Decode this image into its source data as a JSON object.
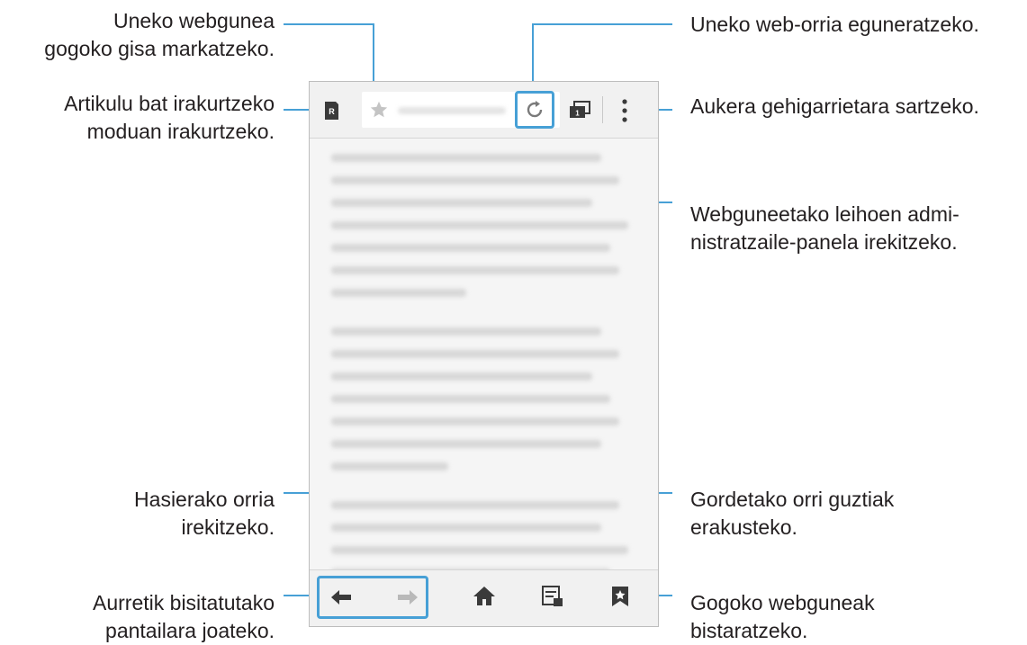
{
  "callouts": {
    "bookmark_page": [
      "Uneko webgunea",
      "gogoko gisa markatzeko."
    ],
    "reader_mode": [
      "Artikulu bat irakurtzeko",
      "moduan irakurtzeko."
    ],
    "refresh": [
      "Uneko web-orria eguneratzeko."
    ],
    "more_options": [
      "Aukera gehigarrietara sartzeko."
    ],
    "window_manager": [
      "Webguneetako leihoen admi-",
      "nistratzaile-panela irekitzeko."
    ],
    "home_page": [
      "Hasierako orria",
      "irekitzeko."
    ],
    "saved_pages": [
      "Gordetako orri guztiak",
      "erakusteko."
    ],
    "back_forward": [
      "Aurretik bisitatutako",
      "pantailara joateko."
    ],
    "bookmarks": [
      "Gogoko webguneak",
      "bistaratzeko."
    ]
  },
  "colors": {
    "highlight": "#47a0d6",
    "icon": "#3a3a3a",
    "icon_disabled": "#b9b9b9",
    "text": "#231f20"
  },
  "icons": {
    "reader": "reader-icon",
    "star": "star-icon",
    "refresh": "refresh-icon",
    "tabs": "tabs-icon",
    "more": "more-icon",
    "back": "back-icon",
    "forward": "forward-icon",
    "home": "home-icon",
    "saved": "saved-pages-icon",
    "bookmarks": "bookmark-icon"
  }
}
